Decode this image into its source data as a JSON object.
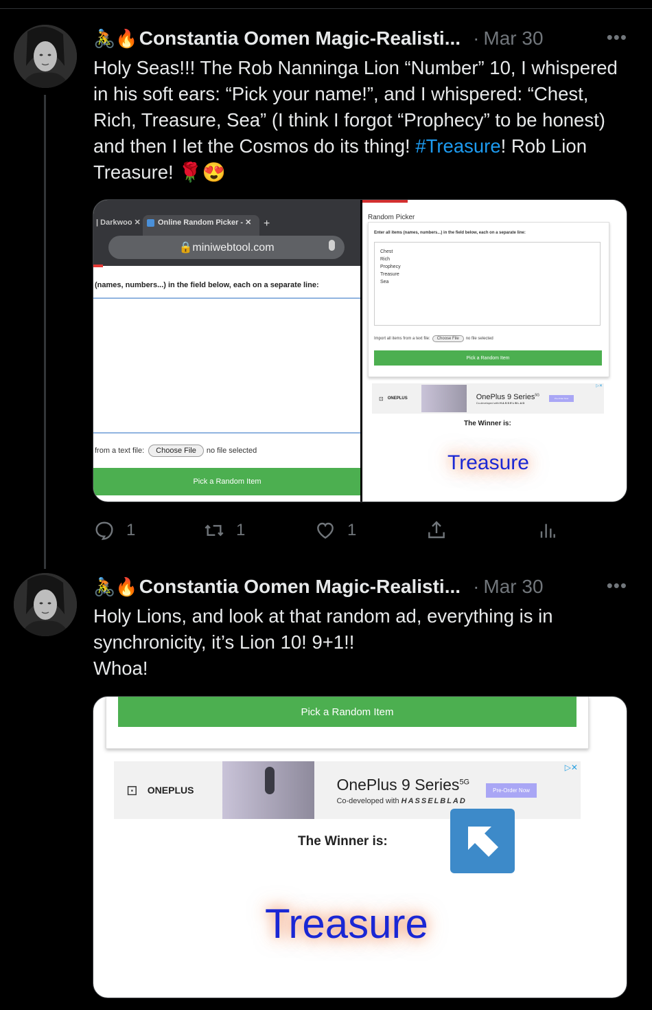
{
  "tweets": [
    {
      "emoji": "🚴🔥",
      "name": "Constantia Oomen Magic-Realisti...",
      "date": "Mar 30",
      "more": "•••",
      "text_before": "Holy Seas!!! The Rob Nanninga Lion “Number” 10, I whispered in his soft ears: “Pick your name!”, and I whispered: “Chest, Rich, Treasure, Sea” (I think I forgot “Prophecy” to be honest) and then I let the Cosmos do its thing! ",
      "hashtag": "#Treasure",
      "text_after": "! Rob Lion Treasure! 🌹😍",
      "replies": "1",
      "retweets": "1",
      "likes": "1"
    },
    {
      "emoji": "🚴🔥",
      "name": "Constantia Oomen Magic-Realisti...",
      "date": "Mar 30",
      "more": "•••",
      "text": "Holy Lions, and look at that random ad, everything is in synchronicity, it’s Lion 10! 9+1!!\nWhoa!"
    }
  ],
  "browser": {
    "tab1": "| Darkwoo  ✕",
    "tab2": "Online Random Picker -  ✕",
    "new_tab": "+",
    "url": "🔒miniwebtool.com",
    "instructions": "(names, numbers...) in the field below, each on a separate line:",
    "file_label": "from a text file:",
    "choose_file": "Choose File",
    "no_file": "no file selected",
    "pick_button": "Pick a Random Item"
  },
  "picker": {
    "title": "Random Picker",
    "instructions": "Enter all items (names, numbers...) in the field below, each on a separate line:",
    "items": [
      "Chest",
      "Rich",
      "Prophecy",
      "Treasure",
      "Sea"
    ],
    "import_label": "Import all items from a text file:",
    "choose_file": "Choose File",
    "no_file": "no file selected",
    "pick_button": "Pick a Random Item",
    "winner_label": "The Winner is:",
    "winner": "Treasure"
  },
  "ad": {
    "brand": "ONEPLUS",
    "product": "OnePlus 9 Series",
    "sup": "5G",
    "tagline": "Co-developed with",
    "partner": "HASSELBLAD",
    "cta": "Pre-Order Now",
    "adchoices": "▷✕"
  },
  "colors": {
    "link": "#1d9bf0",
    "muted": "#71767b",
    "green": "#4caf50",
    "winner": "#1a27d4"
  }
}
